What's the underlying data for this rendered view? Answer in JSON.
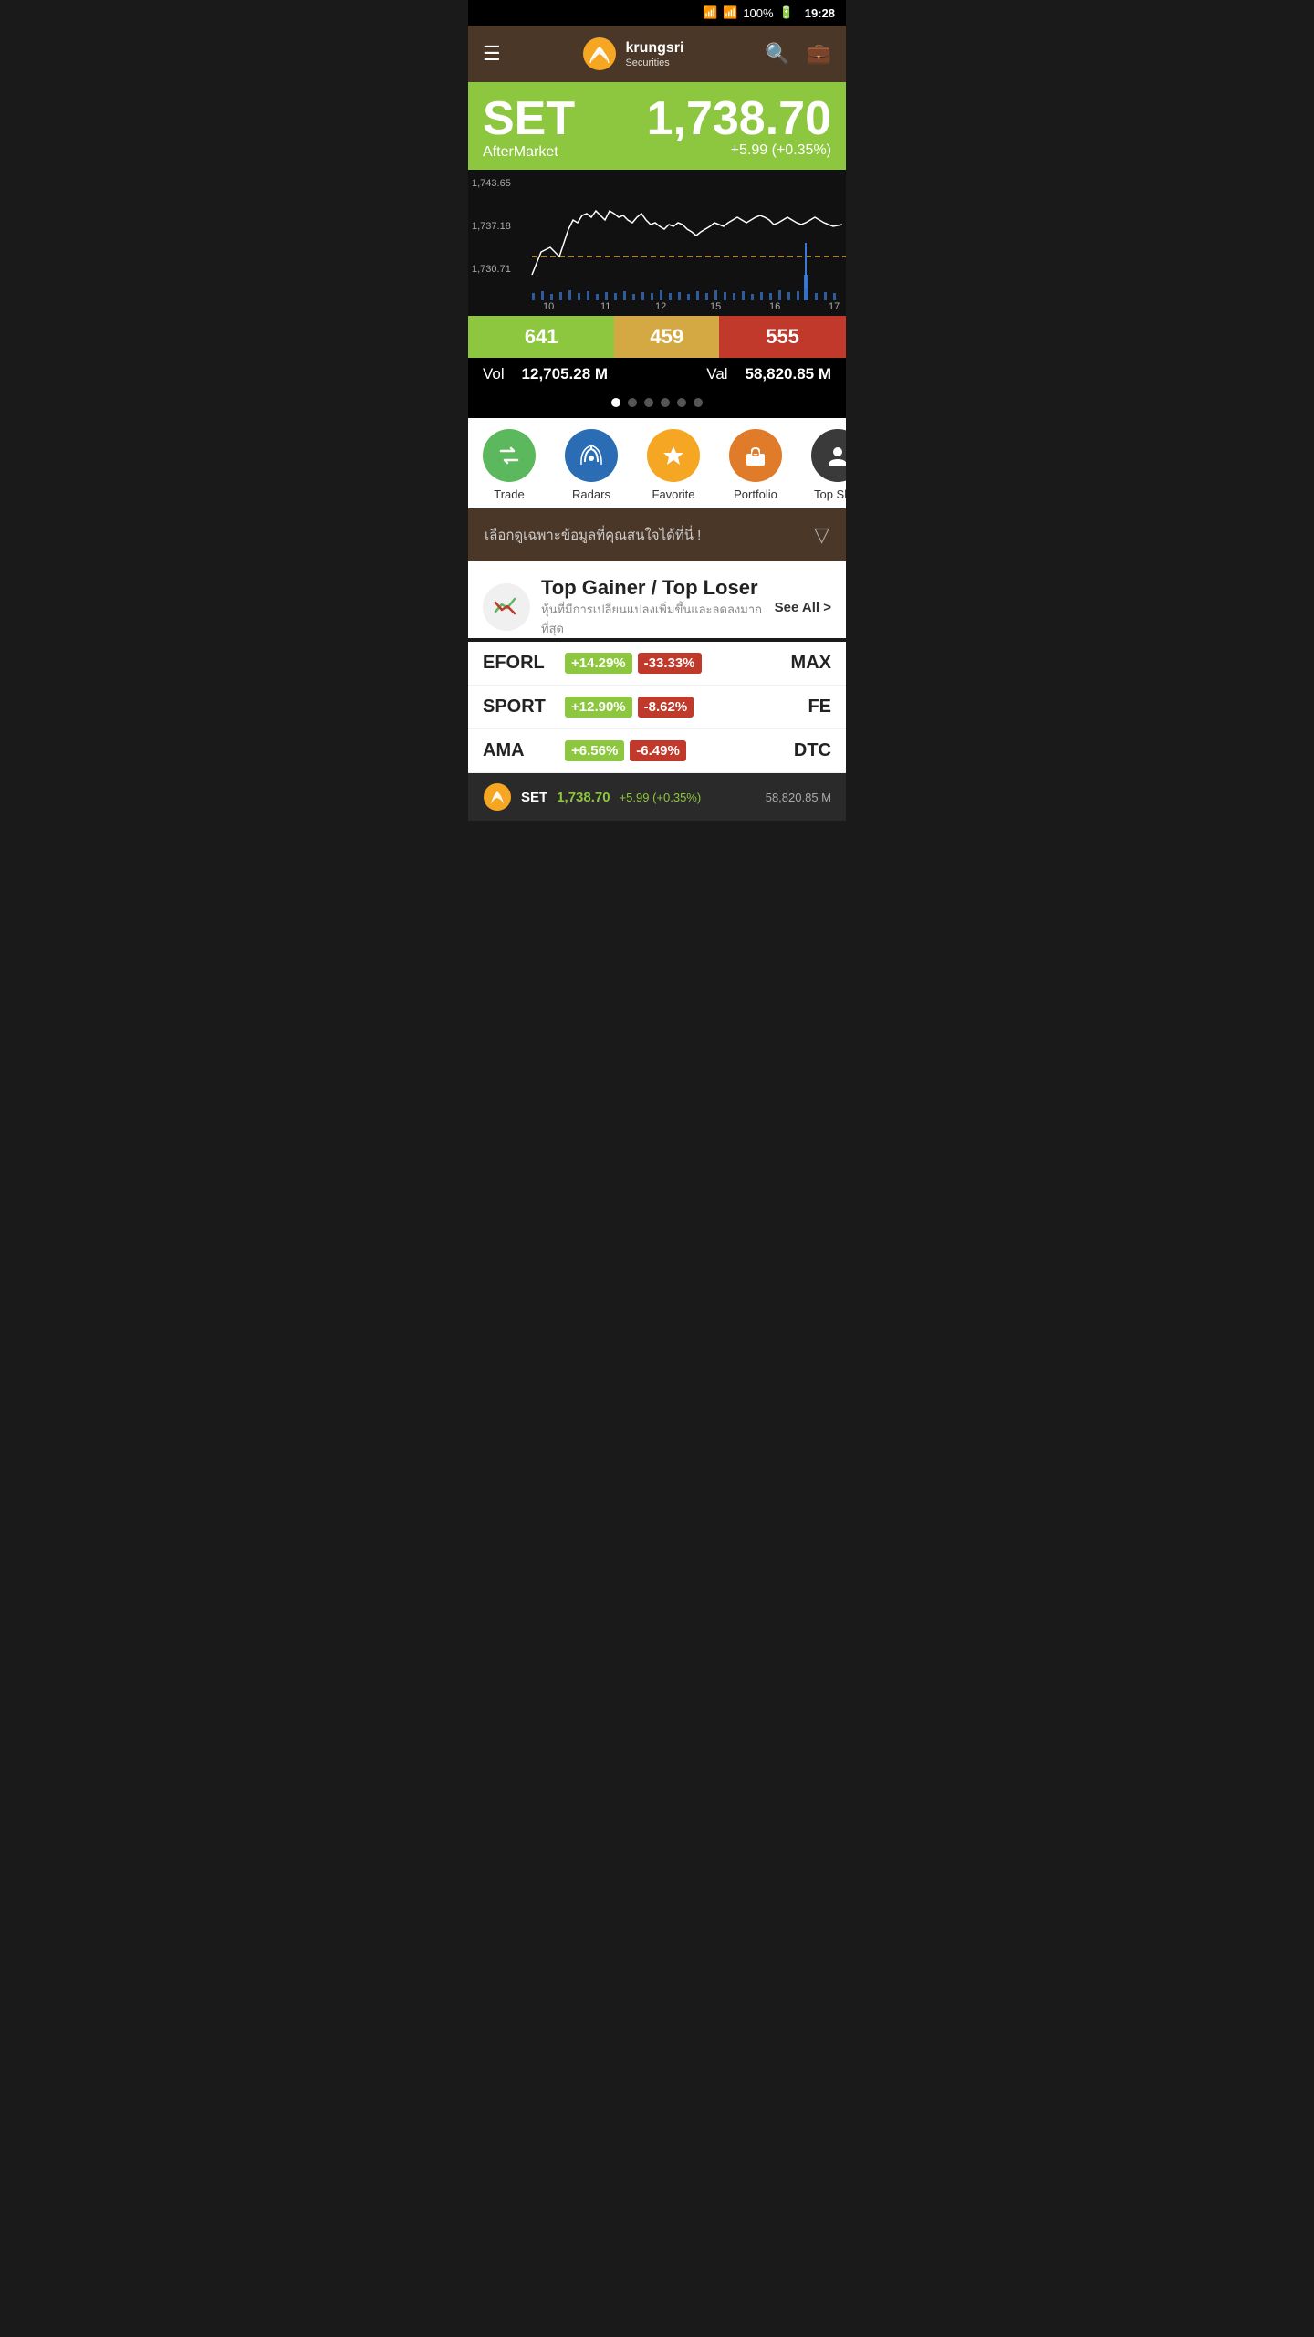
{
  "statusBar": {
    "signal": "wifi+cellular",
    "battery": "100%",
    "time": "19:28"
  },
  "header": {
    "menuIcon": "☰",
    "logoText": "krungsri",
    "logoSub": "Securities",
    "searchIcon": "🔍",
    "briefcaseIcon": "💼"
  },
  "setBanner": {
    "label": "SET",
    "value": "1,738.70",
    "subLeft": "AfterMarket",
    "subRight": "+5.99 (+0.35%)"
  },
  "chart": {
    "yLabels": [
      "1,743.65",
      "1,737.18",
      "1,730.71"
    ],
    "xLabels": [
      "10",
      "11",
      "12",
      "15",
      "16",
      "17"
    ]
  },
  "statsBar": {
    "green": "641",
    "yellow": "459",
    "red": "555",
    "volLabel": "Vol",
    "volValue": "12,705.28 M",
    "valLabel": "Val",
    "valValue": "58,820.85 M"
  },
  "navItems": [
    {
      "label": "Trade",
      "icon": "⇄",
      "color": "green"
    },
    {
      "label": "Radars",
      "icon": "📡",
      "color": "blue"
    },
    {
      "label": "Favorite",
      "icon": "★",
      "color": "yellow"
    },
    {
      "label": "Portfolio",
      "icon": "💼",
      "color": "orange"
    },
    {
      "label": "Top Shar",
      "icon": "👤",
      "color": "dark"
    }
  ],
  "filterBar": {
    "text": "เลือกดูเฉพาะข้อมูลที่คุณสนใจได้ที่นี่ !",
    "icon": "▽"
  },
  "section": {
    "titleLine1": "Top Gainer / Top Loser",
    "subtitle": "หุ้นที่มีการเปลี่ยนแปลงเพิ่มขึ้นและลดลงมากที่สุด",
    "seeAll": "See All >"
  },
  "stocks": [
    {
      "name": "EFORL",
      "gain": "+14.29%",
      "loss": "-33.33%",
      "ticker": "MAX"
    },
    {
      "name": "SPORT",
      "gain": "+12.90%",
      "loss": "-8.62%",
      "ticker": "FE"
    },
    {
      "name": "AMA",
      "gain": "+6.56%",
      "loss": "-6.49%",
      "ticker": "DTC"
    }
  ],
  "bottomBar": {
    "label": "SET",
    "value": "1,738.70",
    "change": "+5.99 (+0.35%)",
    "vol": "58,820.85 M"
  }
}
